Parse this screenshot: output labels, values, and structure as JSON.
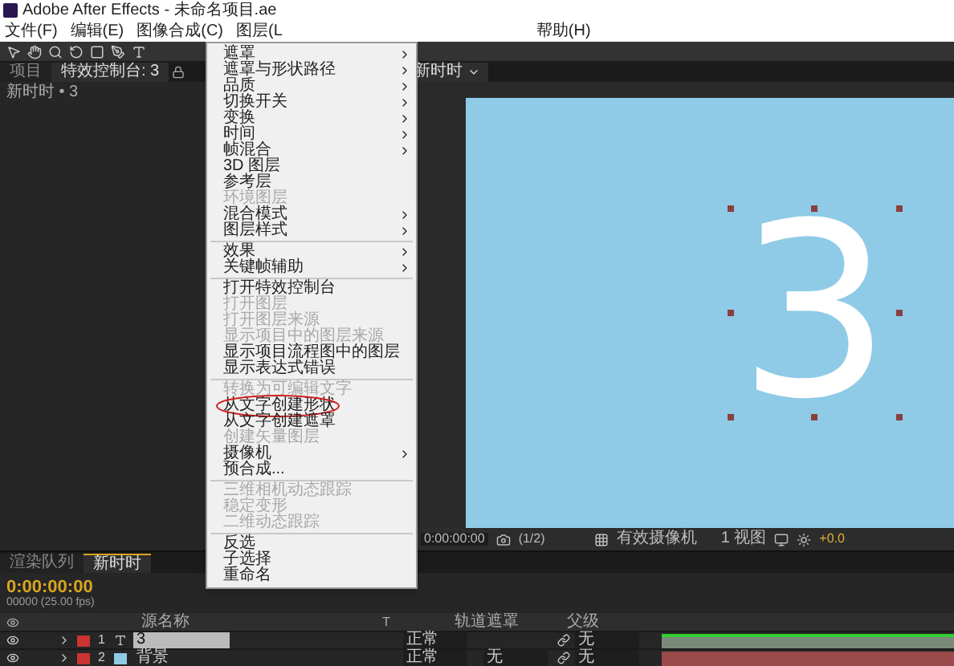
{
  "window": {
    "title": "Adobe After Effects - 未命名项目.ae"
  },
  "menubar": [
    "文件(F)",
    "编辑(E)",
    "图像合成(C)",
    "图层(L",
    "帮助(H)"
  ],
  "panel_tabs": [
    {
      "label": "项目",
      "selected": false
    },
    {
      "label": "特效控制台: 3",
      "selected": true
    }
  ],
  "composition_tab": {
    "label": "新时时"
  },
  "effects_panel": {
    "header": "新时时 • 3"
  },
  "viewer": {
    "glyph": "3",
    "toolbar": {
      "timecode": "0:00:00:00",
      "resolution": "(1/2)",
      "camera": "有效摄像机",
      "views": "1 视图",
      "exposure": "+0.0"
    }
  },
  "context_menu": [
    {
      "kind": "item",
      "label": "遮罩",
      "disabled": false,
      "submenu": true,
      "circled": false
    },
    {
      "kind": "item",
      "label": "遮罩与形状路径",
      "disabled": false,
      "submenu": true,
      "circled": false
    },
    {
      "kind": "item",
      "label": "品质",
      "disabled": false,
      "submenu": true,
      "circled": false
    },
    {
      "kind": "item",
      "label": "切换开关",
      "disabled": false,
      "submenu": true,
      "circled": false
    },
    {
      "kind": "item",
      "label": "变换",
      "disabled": false,
      "submenu": true,
      "circled": false
    },
    {
      "kind": "item",
      "label": "时间",
      "disabled": false,
      "submenu": true,
      "circled": false
    },
    {
      "kind": "item",
      "label": "帧混合",
      "disabled": false,
      "submenu": true,
      "circled": false
    },
    {
      "kind": "item",
      "label": "3D 图层",
      "disabled": false,
      "submenu": false,
      "circled": false
    },
    {
      "kind": "item",
      "label": "参考层",
      "disabled": false,
      "submenu": false,
      "circled": false
    },
    {
      "kind": "item",
      "label": "环境图层",
      "disabled": true,
      "submenu": false,
      "circled": false
    },
    {
      "kind": "item",
      "label": "混合模式",
      "disabled": false,
      "submenu": true,
      "circled": false
    },
    {
      "kind": "item",
      "label": "图层样式",
      "disabled": false,
      "submenu": true,
      "circled": false
    },
    {
      "kind": "separator"
    },
    {
      "kind": "item",
      "label": "效果",
      "disabled": false,
      "submenu": true,
      "circled": false
    },
    {
      "kind": "item",
      "label": "关键帧辅助",
      "disabled": false,
      "submenu": true,
      "circled": false
    },
    {
      "kind": "separator"
    },
    {
      "kind": "item",
      "label": "打开特效控制台",
      "disabled": false,
      "submenu": false,
      "circled": false
    },
    {
      "kind": "item",
      "label": "打开图层",
      "disabled": true,
      "submenu": false,
      "circled": false
    },
    {
      "kind": "item",
      "label": "打开图层来源",
      "disabled": true,
      "submenu": false,
      "circled": false
    },
    {
      "kind": "item",
      "label": "显示项目中的图层来源",
      "disabled": true,
      "submenu": false,
      "circled": false
    },
    {
      "kind": "item",
      "label": "显示项目流程图中的图层",
      "disabled": false,
      "submenu": false,
      "circled": false
    },
    {
      "kind": "item",
      "label": "显示表达式错误",
      "disabled": false,
      "submenu": false,
      "circled": false
    },
    {
      "kind": "separator"
    },
    {
      "kind": "item",
      "label": "转换为可编辑文字",
      "disabled": true,
      "submenu": false,
      "circled": false
    },
    {
      "kind": "item",
      "label": "从文字创建形状",
      "disabled": false,
      "submenu": false,
      "circled": true
    },
    {
      "kind": "item",
      "label": "从文字创建遮罩",
      "disabled": false,
      "submenu": false,
      "circled": false
    },
    {
      "kind": "item",
      "label": "创建矢量图层",
      "disabled": true,
      "submenu": false,
      "circled": false
    },
    {
      "kind": "item",
      "label": "摄像机",
      "disabled": false,
      "submenu": true,
      "circled": false
    },
    {
      "kind": "item",
      "label": "预合成...",
      "disabled": false,
      "submenu": false,
      "circled": false
    },
    {
      "kind": "separator"
    },
    {
      "kind": "item",
      "label": "三维相机动态跟踪",
      "disabled": true,
      "submenu": false,
      "circled": false
    },
    {
      "kind": "item",
      "label": "稳定变形",
      "disabled": true,
      "submenu": false,
      "circled": false
    },
    {
      "kind": "item",
      "label": "二维动态跟踪",
      "disabled": true,
      "submenu": false,
      "circled": false
    },
    {
      "kind": "separator"
    },
    {
      "kind": "item",
      "label": "反选",
      "disabled": false,
      "submenu": false,
      "circled": false
    },
    {
      "kind": "item",
      "label": "子选择",
      "disabled": false,
      "submenu": false,
      "circled": false
    },
    {
      "kind": "item",
      "label": "重命名",
      "disabled": false,
      "submenu": false,
      "circled": false
    }
  ],
  "timeline": {
    "tabs": [
      {
        "label": "渲染队列",
        "selected": false
      },
      {
        "label": "新时时",
        "selected": true
      }
    ],
    "timecode": "0:00:00:00",
    "frame_info": "00000 (25.00 fps)",
    "columns": {
      "source_name": "源名称",
      "mode_t": "T",
      "track_matte": "轨道遮罩",
      "parent": "父级"
    },
    "layers": [
      {
        "number": "1",
        "name": "3",
        "kind": "text",
        "selected": true,
        "mode": "正常",
        "parent": "无"
      },
      {
        "number": "2",
        "name": "背景",
        "kind": "solid",
        "selected": false,
        "mode": "正常",
        "track_matte": "无",
        "parent": "无"
      }
    ]
  }
}
